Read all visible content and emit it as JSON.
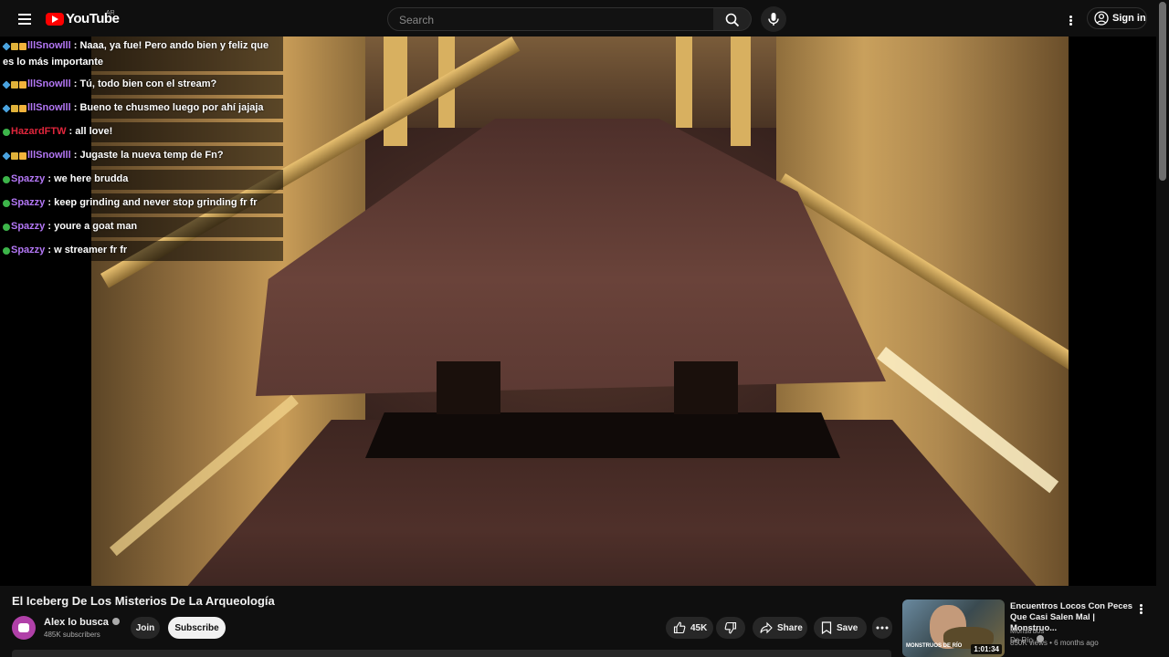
{
  "header": {
    "logo_text": "YouTube",
    "country_code": "AR",
    "search_placeholder": "Search",
    "sign_in_label": "Sign in"
  },
  "chat": [
    {
      "badges": [
        "diamond",
        "sub",
        "mod"
      ],
      "user": "lllSnowlll",
      "user_color": "#b377f5",
      "message": "Naaa, ya fue! Pero ando bien y feliz que es lo más importante"
    },
    {
      "badges": [
        "diamond",
        "sub",
        "mod"
      ],
      "user": "lllSnowlll",
      "user_color": "#b377f5",
      "message": "Tú, todo bien con el stream?"
    },
    {
      "badges": [
        "diamond",
        "sub",
        "mod"
      ],
      "user": "lllSnowlll",
      "user_color": "#b377f5",
      "message": "Bueno te chusmeo luego por ahí jajaja"
    },
    {
      "badges": [
        "green"
      ],
      "user": "HazardFTW",
      "user_color": "#e0263c",
      "message": "all love!"
    },
    {
      "badges": [
        "diamond",
        "sub",
        "mod"
      ],
      "user": "lllSnowlll",
      "user_color": "#b377f5",
      "message": "Jugaste la nueva temp de Fn?"
    },
    {
      "badges": [
        "green"
      ],
      "user": "Spazzy",
      "user_color": "#b377f5",
      "message": "we here brudda"
    },
    {
      "badges": [
        "green"
      ],
      "user": "Spazzy",
      "user_color": "#b377f5",
      "message": "keep grinding and never stop grinding fr fr"
    },
    {
      "badges": [
        "green"
      ],
      "user": "Spazzy",
      "user_color": "#b377f5",
      "message": "youre a goat man"
    },
    {
      "badges": [
        "green"
      ],
      "user": "Spazzy",
      "user_color": "#b377f5",
      "message": "w streamer fr fr"
    }
  ],
  "video": {
    "title": "El Iceberg De Los Misterios De La Arqueología",
    "channel_name": "Alex lo busca",
    "subscribers": "485K subscribers",
    "join_label": "Join",
    "subscribe_label": "Subscribe",
    "like_count": "45K",
    "share_label": "Share",
    "save_label": "Save"
  },
  "recommendation": {
    "title": "Encuentros Locos Con Peces Que Casi Salen Mal | Monstruo...",
    "channel": "Monstruos De Río",
    "views": "850K views",
    "age": "6 months ago",
    "duration": "1:01:34",
    "thumb_brand": "MONSTRUOS DE RÍO"
  },
  "colors": {
    "background": "#0f0f0f",
    "brand_red": "#ff0000",
    "chip_bg": "#272727",
    "subscribe_bg": "#f1f1f1"
  }
}
